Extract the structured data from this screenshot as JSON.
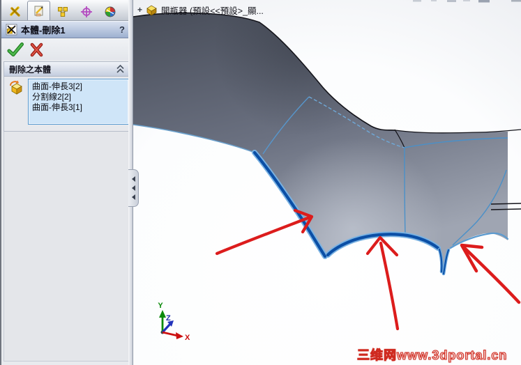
{
  "panel": {
    "title": "本體-刪除1",
    "help": "?",
    "delete_group": {
      "header": "刪除之本體",
      "bodies": [
        "曲面-伸長3[2]",
        "分割線2[2]",
        "曲面-伸長3[1]"
      ]
    }
  },
  "icons": {
    "tab1": "featuremanager-tree-icon",
    "tab2": "propertymanager-icon",
    "tab3": "configurationmanager-icon",
    "tab4": "dimxpertmanager-icon",
    "tab5": "displaymanager-icon",
    "ok": "ok-check-icon",
    "cancel": "cancel-x-icon",
    "collapse": "collapse-chevron-icon",
    "bodies": "solid-bodies-icon",
    "title_icon": "delete-body-icon",
    "part": "part-document-icon"
  },
  "graphics": {
    "feature_tree": {
      "expand": "+",
      "part_label": "開瓶器 (預設<<預設>_顯..."
    },
    "triad": {
      "x": "X",
      "y": "Y",
      "z": "Z"
    },
    "watermark": "三维网www.3dportal.cn"
  },
  "colors": {
    "selection_blue": "#0b4fa6",
    "edge_highlight_blue": "#4a90c8",
    "annotation_red": "#dc1c1c",
    "model_gray_dark": "#4b505d",
    "model_gray_light": "#a8aeba",
    "listbox_bg": "#cfe5f8",
    "watermark_red": "#cf2a20",
    "triad_x_red": "#cc1111",
    "triad_y_green": "#0a8a0a",
    "triad_z_blue": "#2233bb"
  }
}
